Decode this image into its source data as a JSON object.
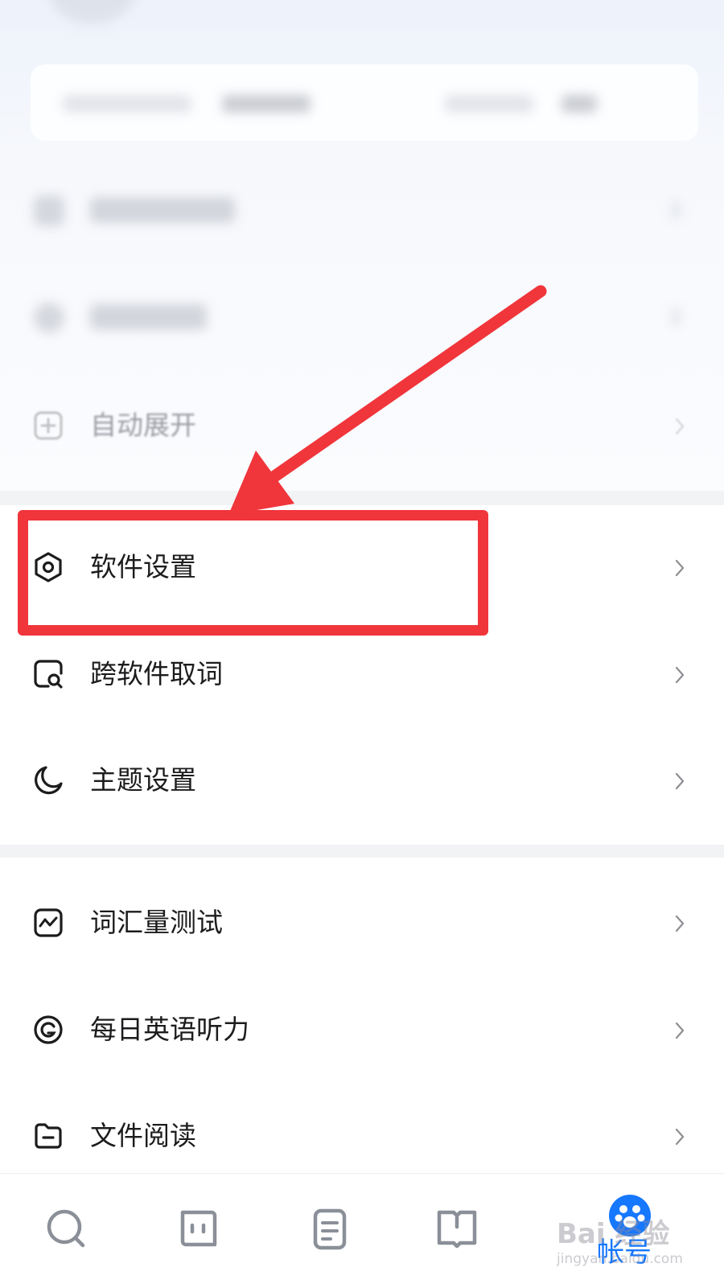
{
  "menu": {
    "faded_item": {
      "label": "自动展开"
    },
    "group_settings": [
      {
        "label": "软件设置",
        "icon": "hexagon-gear-icon"
      },
      {
        "label": "跨软件取词",
        "icon": "search-screen-icon"
      },
      {
        "label": "主题设置",
        "icon": "moon-icon"
      }
    ],
    "group_tools": [
      {
        "label": "词汇量测试",
        "icon": "chart-wave-icon"
      },
      {
        "label": "每日英语听力",
        "icon": "listening-icon"
      },
      {
        "label": "文件阅读",
        "icon": "folder-icon"
      }
    ]
  },
  "tabbar": {
    "tabs": [
      {
        "icon": "search-icon"
      },
      {
        "icon": "chat-icon"
      },
      {
        "icon": "notes-icon"
      },
      {
        "icon": "book-icon"
      },
      {
        "icon": "account-icon"
      }
    ],
    "active_label": "帐号",
    "accent_color": "#1677ff"
  },
  "annotation": {
    "color": "#f0353b"
  },
  "watermark": {
    "main": "Bai 经验",
    "sub": "jingyan.baidu.com"
  }
}
